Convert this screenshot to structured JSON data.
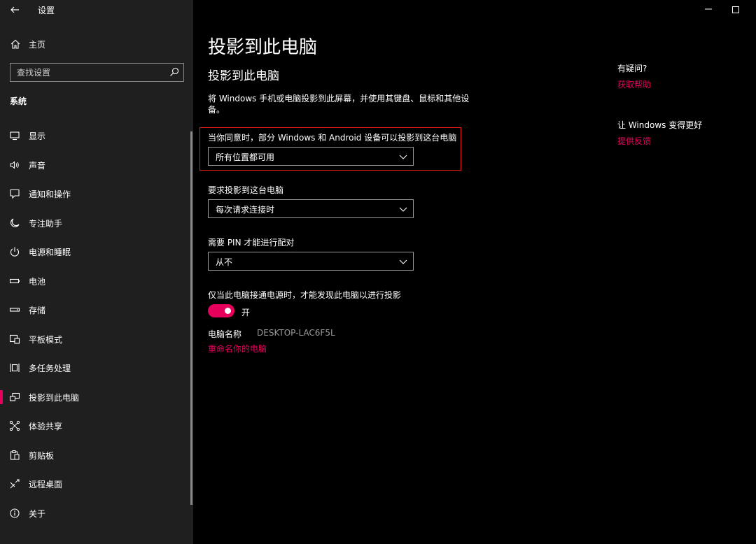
{
  "window": {
    "title": "设置"
  },
  "sidebar": {
    "home_label": "主页",
    "search_placeholder": "查找设置",
    "section_label": "系统",
    "items": [
      {
        "label": "显示",
        "icon": "monitor-icon"
      },
      {
        "label": "声音",
        "icon": "speaker-icon"
      },
      {
        "label": "通知和操作",
        "icon": "notification-icon"
      },
      {
        "label": "专注助手",
        "icon": "moon-icon"
      },
      {
        "label": "电源和睡眠",
        "icon": "power-icon"
      },
      {
        "label": "电池",
        "icon": "battery-icon"
      },
      {
        "label": "存储",
        "icon": "storage-icon"
      },
      {
        "label": "平板模式",
        "icon": "tablet-icon"
      },
      {
        "label": "多任务处理",
        "icon": "multitask-icon"
      },
      {
        "label": "投影到此电脑",
        "icon": "project-icon",
        "active": true
      },
      {
        "label": "体验共享",
        "icon": "share-icon"
      },
      {
        "label": "剪贴板",
        "icon": "clipboard-icon"
      },
      {
        "label": "远程桌面",
        "icon": "remote-icon"
      },
      {
        "label": "关于",
        "icon": "info-icon"
      }
    ]
  },
  "main": {
    "page_title": "投影到此电脑",
    "sub_title": "投影到此电脑",
    "description": "将 Windows 手机或电脑投影到此屏幕，并使用其键盘、鼠标和其他设备。",
    "setting1": {
      "label": "当你同意时，部分 Windows 和 Android 设备可以投影到这台电脑",
      "value": "所有位置都可用"
    },
    "setting2": {
      "label": "要求投影到这台电脑",
      "value": "每次请求连接时"
    },
    "setting3": {
      "label": "需要 PIN 才能进行配对",
      "value": "从不"
    },
    "setting4": {
      "label": "仅当此电脑接通电源时，才能发现此电脑以进行投影",
      "toggle_state": "开",
      "toggle_on": true
    },
    "pc_name_label": "电脑名称",
    "pc_name_value": "DESKTOP-LAC6F5L",
    "rename_link": "重命名你的电脑"
  },
  "right": {
    "help_question": "有疑问?",
    "help_link": "获取帮助",
    "better_title": "让 Windows 变得更好",
    "feedback_link": "提供反馈"
  },
  "colors": {
    "accent": "#e6005c",
    "sidebar_bg": "#1f1f1f",
    "main_bg": "#000000",
    "highlight": "#e11d1d"
  }
}
